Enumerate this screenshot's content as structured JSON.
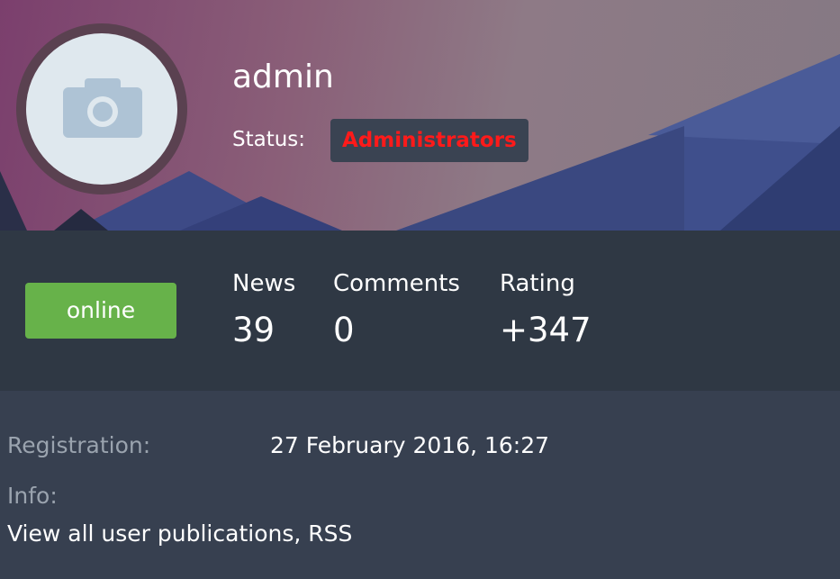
{
  "profile": {
    "username": "admin",
    "status_label": "Status:",
    "status_group": "Administrators",
    "avatar_icon": "camera-icon",
    "online_label": "online"
  },
  "stats": [
    {
      "label": "News",
      "value": "39"
    },
    {
      "label": "Comments",
      "value": "0"
    },
    {
      "label": "Rating",
      "value": "+347"
    }
  ],
  "details": {
    "registration_label": "Registration:",
    "registration_value": "27 February 2016, 16:27",
    "info_label": "Info:",
    "publications_link": "View all user publications",
    "separator": ", ",
    "rss_link": "RSS"
  },
  "colors": {
    "status_text": "#ff1a1a",
    "online_button": "#67b24a",
    "stats_band": "#2f3844",
    "details_panel": "#374050"
  }
}
